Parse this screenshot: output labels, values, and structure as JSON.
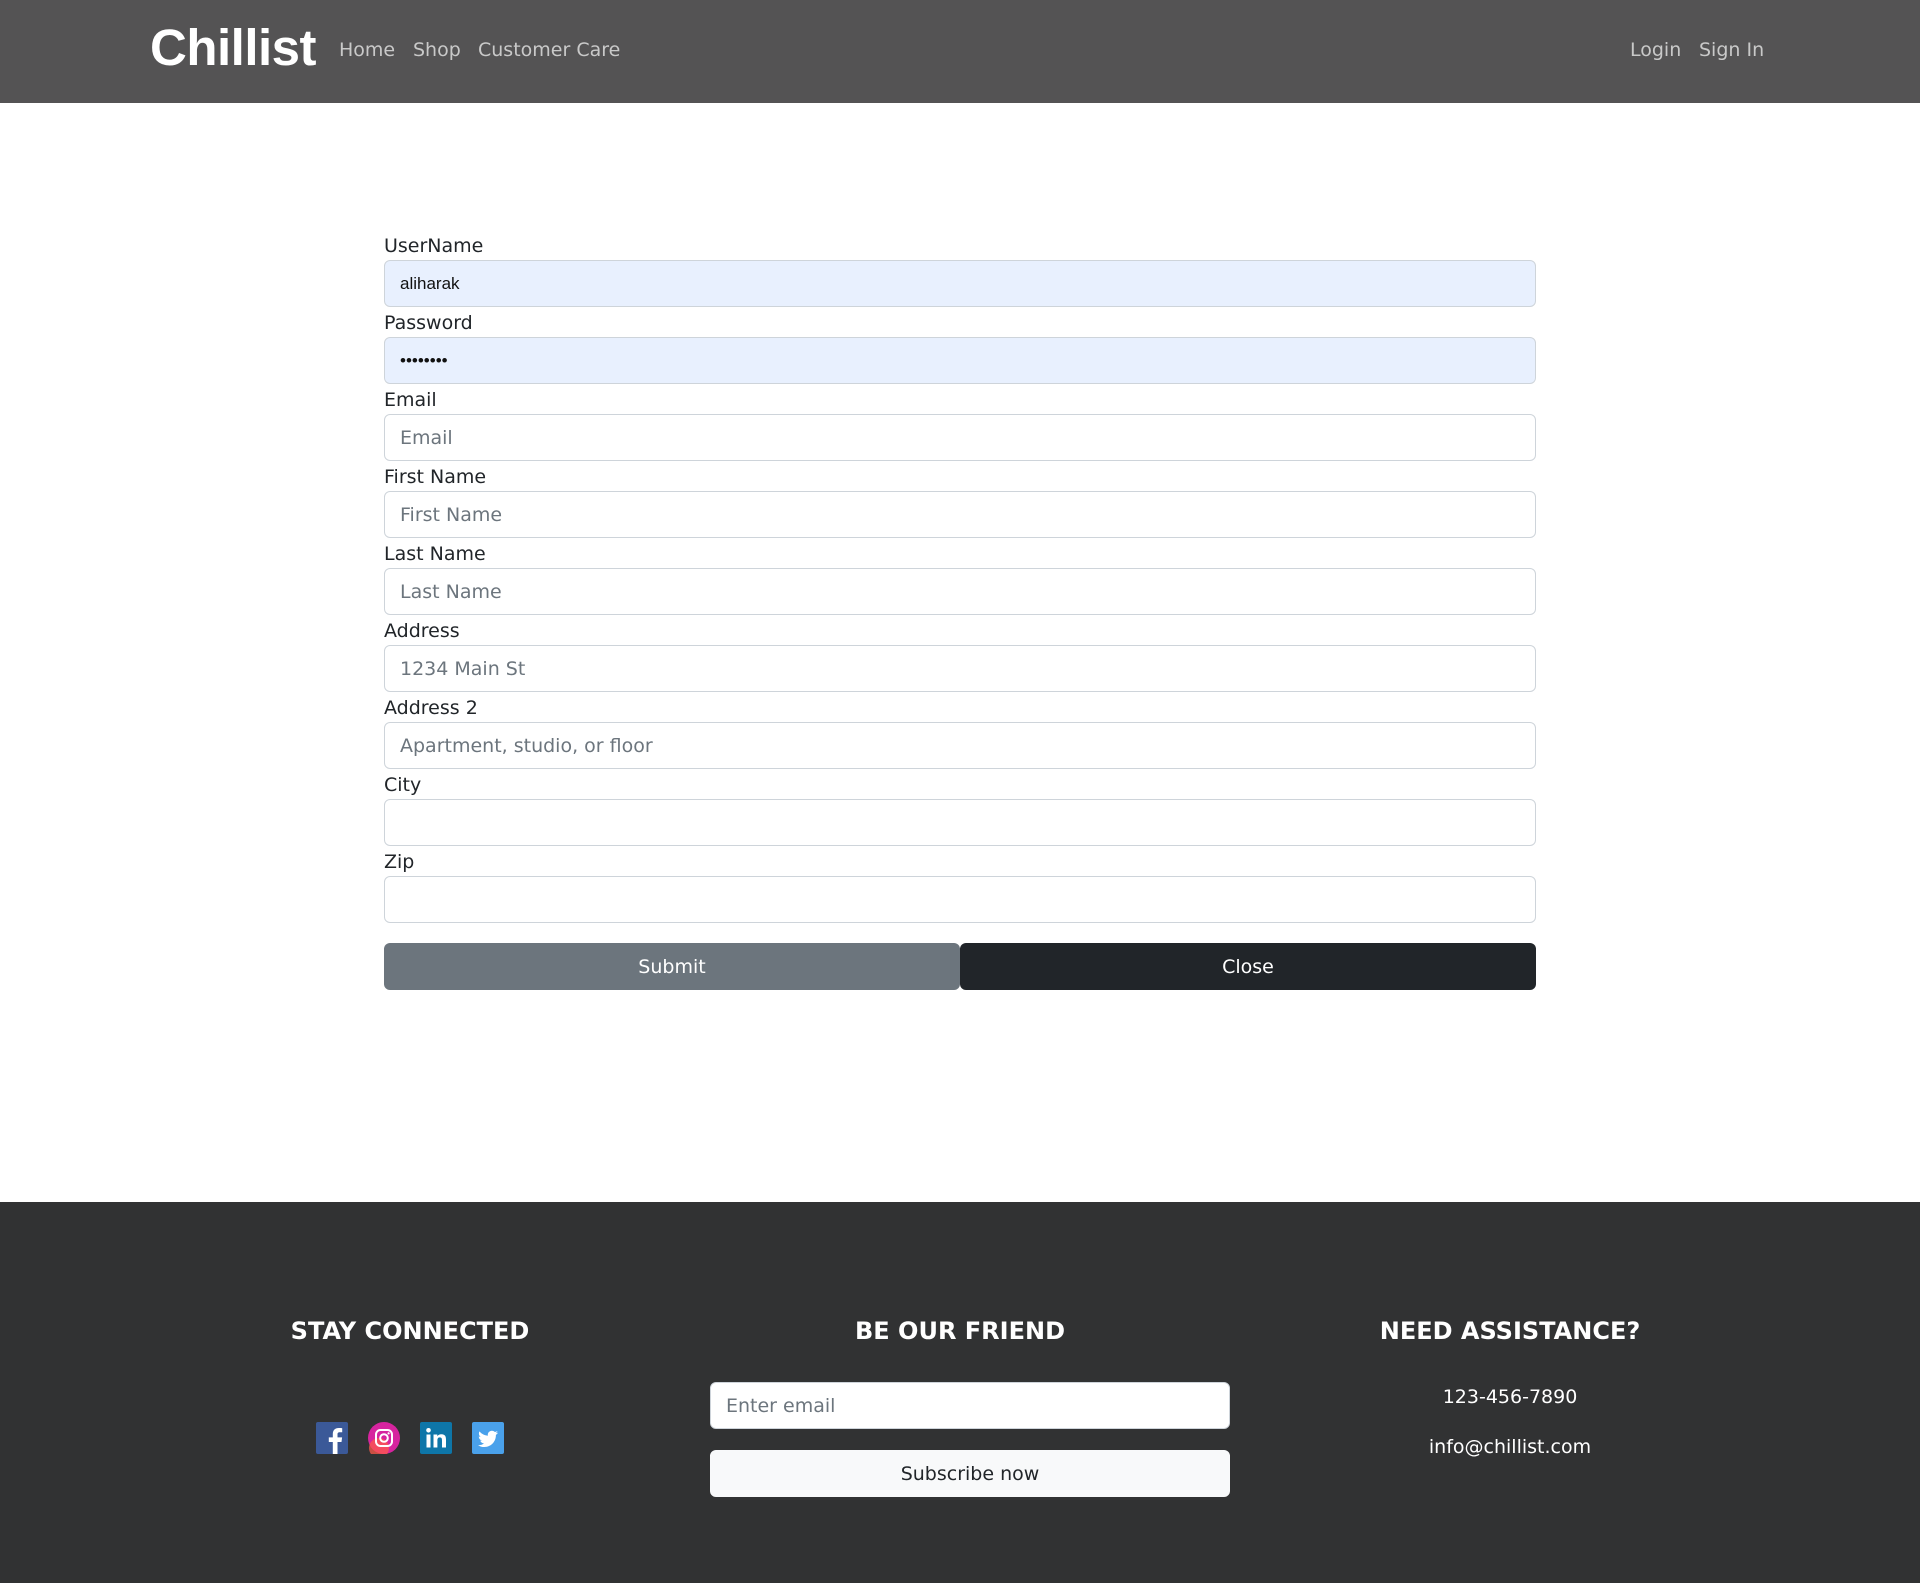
{
  "navbar": {
    "brand": "Chillist",
    "links": [
      "Home",
      "Shop",
      "Customer Care"
    ],
    "right_links": [
      "Login",
      "Sign In"
    ]
  },
  "form": {
    "fields": [
      {
        "label": "UserName",
        "value": "aliharak",
        "placeholder": ""
      },
      {
        "label": "Password",
        "value": "aliharak",
        "placeholder": ""
      },
      {
        "label": "Email",
        "value": "",
        "placeholder": "Email"
      },
      {
        "label": "First Name",
        "value": "",
        "placeholder": "First Name"
      },
      {
        "label": "Last Name",
        "value": "",
        "placeholder": "Last Name"
      },
      {
        "label": "Address",
        "value": "",
        "placeholder": "1234 Main St"
      },
      {
        "label": "Address 2",
        "value": "",
        "placeholder": "Apartment, studio, or floor"
      },
      {
        "label": "City",
        "value": "",
        "placeholder": ""
      },
      {
        "label": "Zip",
        "value": "",
        "placeholder": ""
      }
    ],
    "submit_label": "Submit",
    "close_label": "Close"
  },
  "footer": {
    "stay_connected": {
      "heading": "STAY CONNECTED",
      "icons": [
        "facebook-icon",
        "instagram-icon",
        "linkedin-icon",
        "twitter-icon"
      ]
    },
    "be_our_friend": {
      "heading": "BE OUR FRIEND",
      "email_placeholder": "Enter email",
      "subscribe_label": "Subscribe now"
    },
    "need_assistance": {
      "heading": "NEED ASSISTANCE?",
      "phone": "123-456-7890",
      "email": "info@chillist.com"
    }
  },
  "colors": {
    "navbar_bg": "#545354",
    "footer_bg": "#313233",
    "autofill_bg": "#e8f0fe",
    "submit_bg": "#6c757d",
    "close_bg": "#212529"
  }
}
